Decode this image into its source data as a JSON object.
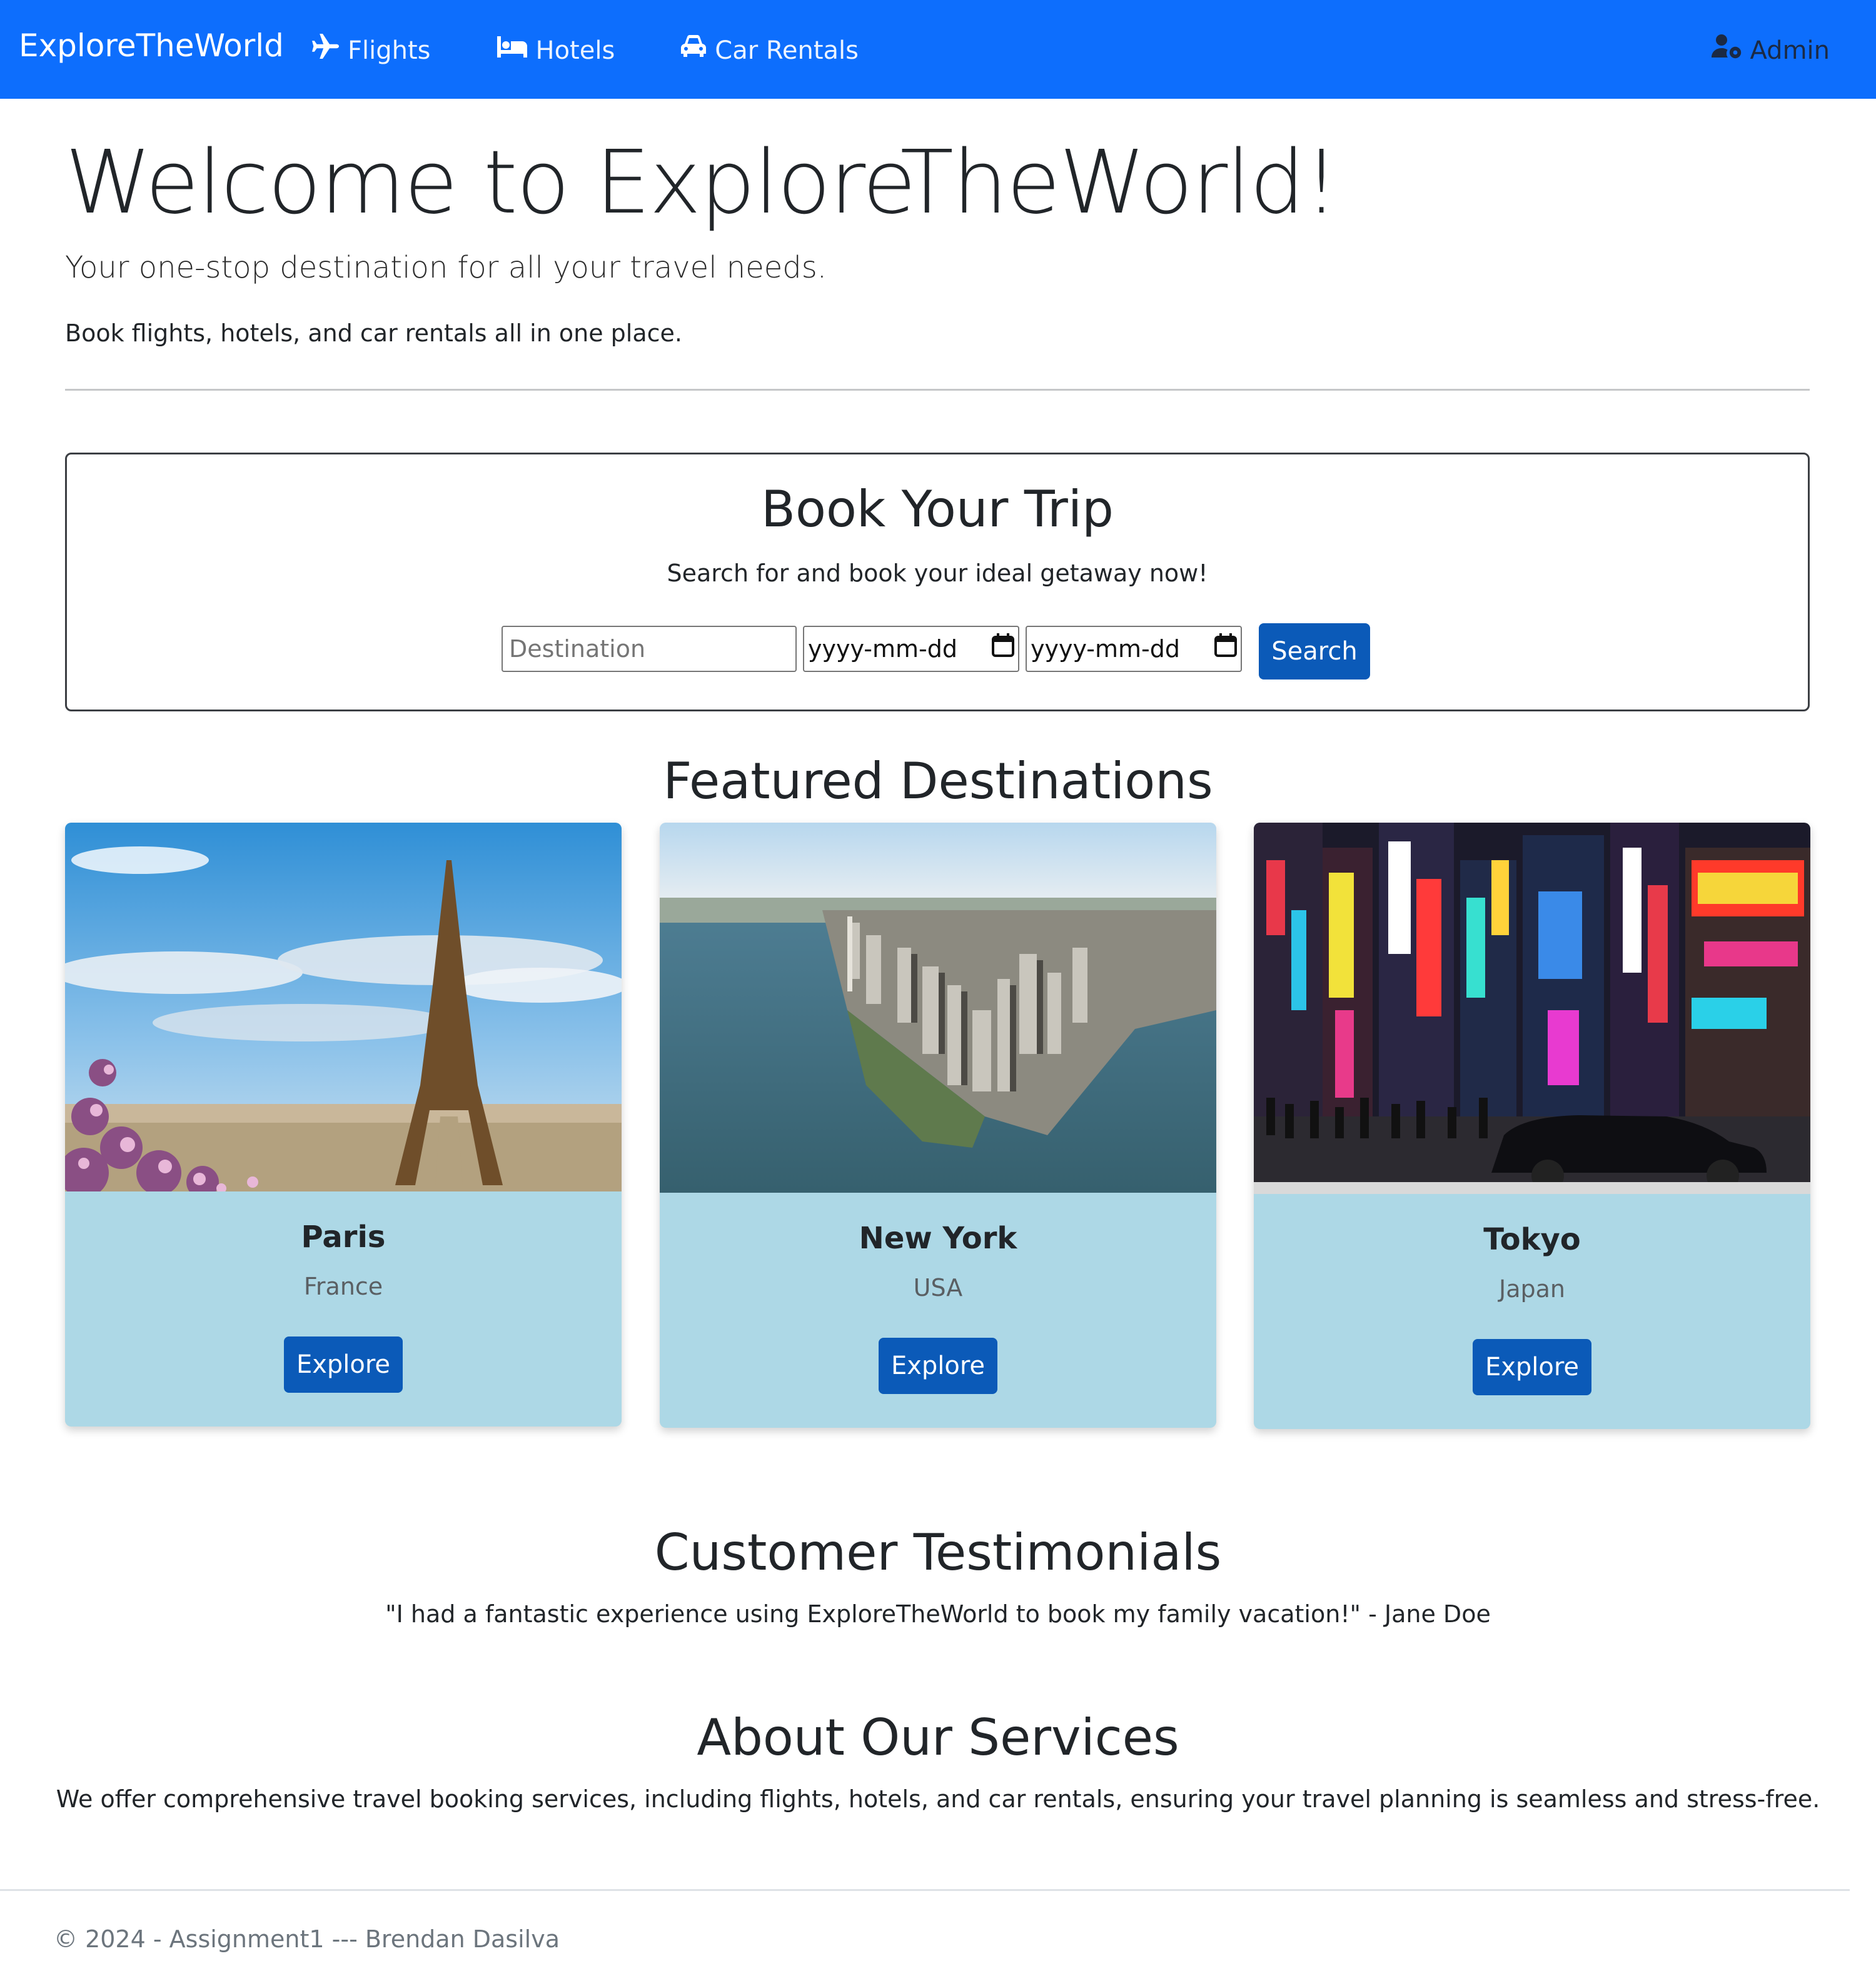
{
  "navbar": {
    "brand": "ExploreTheWorld",
    "links": [
      {
        "label": "Flights",
        "icon": "plane-icon"
      },
      {
        "label": "Hotels",
        "icon": "bed-icon"
      },
      {
        "label": "Car Rentals",
        "icon": "car-icon"
      }
    ],
    "admin": {
      "label": "Admin",
      "icon": "user-gear-icon"
    },
    "colors": {
      "background": "#0d6efd"
    }
  },
  "hero": {
    "title": "Welcome to ExploreTheWorld!",
    "lead": "Your one-stop destination for all your travel needs.",
    "text": "Book flights, hotels, and car rentals all in one place."
  },
  "booking": {
    "title": "Book Your Trip",
    "subtitle": "Search for and book your ideal getaway now!",
    "destination_placeholder": "Destination",
    "check_in_placeholder": "yyyy-mm-dd",
    "check_out_placeholder": "yyyy-mm-dd",
    "search_label": "Search"
  },
  "featured": {
    "title": "Featured Destinations",
    "cards": [
      {
        "city": "Paris",
        "country": "France",
        "button": "Explore"
      },
      {
        "city": "New York",
        "country": "USA",
        "button": "Explore"
      },
      {
        "city": "Tokyo",
        "country": "Japan",
        "button": "Explore"
      }
    ],
    "colors": {
      "card_background": "#add8e6",
      "button": "#0b5ab8"
    }
  },
  "testimonials": {
    "title": "Customer Testimonials",
    "quote": "\"I had a fantastic experience using ExploreTheWorld to book my family vacation!\" - Jane Doe"
  },
  "about": {
    "title": "About Our Services",
    "text": "We offer comprehensive travel booking services, including flights, hotels, and car rentals, ensuring your travel planning is seamless and stress-free."
  },
  "footer": {
    "text": "© 2024 - Assignment1 --- Brendan Dasilva"
  }
}
